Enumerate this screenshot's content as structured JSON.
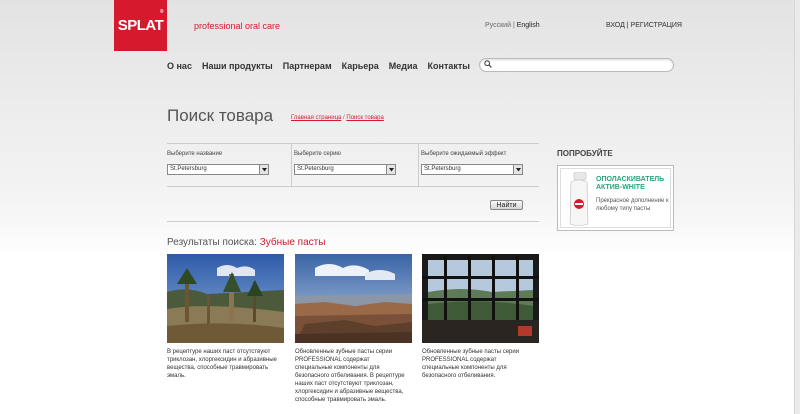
{
  "header": {
    "logo_text": "SPLAT",
    "logo_reg": "®",
    "tagline": "professional oral care",
    "lang": {
      "ru": "Русский",
      "sep": "|",
      "en": "English"
    },
    "auth": {
      "login": "ВХОД",
      "sep": "|",
      "register": "РЕГИСТРАЦИЯ"
    }
  },
  "nav": [
    "О нас",
    "Наши продукты",
    "Партнерам",
    "Карьера",
    "Медиа",
    "Контакты"
  ],
  "search": {
    "value": "",
    "placeholder": ""
  },
  "page": {
    "title": "Поиск товара",
    "breadcrumb": {
      "home": "Главная страница",
      "sep": "/",
      "current": "Поиск товара"
    }
  },
  "filters": [
    {
      "label": "Выберите название",
      "value": "St.Petersburg"
    },
    {
      "label": "Выберите серию",
      "value": "St.Petersburg"
    },
    {
      "label": "Выберите ожидаемый эффект",
      "value": "St.Petersburg"
    }
  ],
  "find_button": "Найти",
  "results": {
    "heading": "Результаты поиска:",
    "category": "Зубные пасты",
    "items": [
      {
        "desc": "В рецептуре наших паст отсутствуют триклозан, хлоргексидин и абразивные вещества, способные травмировать эмаль."
      },
      {
        "desc": "Обновленные зубные пасты серии PROFESSIONAL содержат специальные компоненты для безопасного отбеливания. В рецептуре наших паст отсутствуют триклозан, хлоргексидин и абразивные вещества, способные травмировать эмаль."
      },
      {
        "desc": "Обновленные зубные пасты серии PROFESSIONAL содержат специальные компоненты для безопасного отбеливания."
      }
    ]
  },
  "sidebar": {
    "try_title": "ПОПРОБУЙТЕ",
    "promo_title_1": "ОПОЛАСКИВАТЕЛЬ",
    "promo_title_2": "АКТИВ-WHITE",
    "promo_text": "Прекрасное дополнение к любому типу пасты"
  },
  "colors": {
    "brand": "#d7192d",
    "promo_green": "#29a37c"
  }
}
